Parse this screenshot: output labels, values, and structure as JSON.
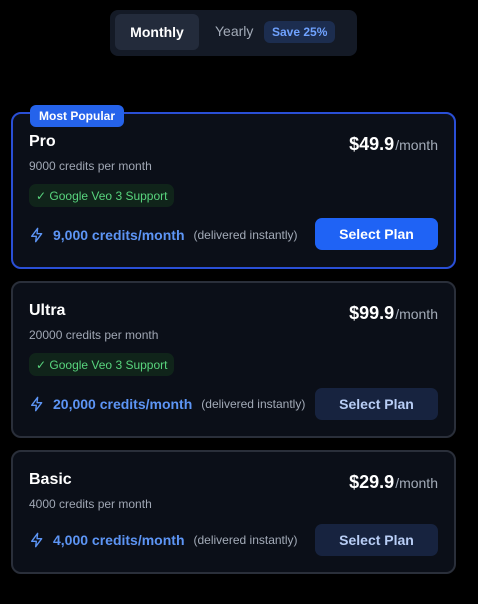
{
  "billing_toggle": {
    "monthly_label": "Monthly",
    "yearly_label": "Yearly",
    "save_badge": "Save 25%",
    "selected": "monthly"
  },
  "plans": [
    {
      "badge": "Most Popular",
      "name": "Pro",
      "subtitle": "9000 credits per month",
      "price": "$49.9",
      "period": "/month",
      "feature": "✓ Google Veo 3 Support",
      "credits": "9,000 credits/month",
      "credits_note": "(delivered instantly)",
      "button_label": "Select Plan"
    },
    {
      "name": "Ultra",
      "subtitle": "20000 credits per month",
      "price": "$99.9",
      "period": "/month",
      "feature": "✓ Google Veo 3 Support",
      "credits": "20,000 credits/month",
      "credits_note": "(delivered instantly)",
      "button_label": "Select Plan"
    },
    {
      "name": "Basic",
      "subtitle": "4000 credits per month",
      "price": "$29.9",
      "period": "/month",
      "credits": "4,000 credits/month",
      "credits_note": "(delivered instantly)",
      "button_label": "Select Plan"
    }
  ],
  "colors": {
    "accent": "#2563eb",
    "popular_border": "#2a4fd6",
    "feature_green": "#58d47d",
    "credits_blue": "#5d95f5"
  },
  "icons": {
    "credits": "lightning-bolt-icon"
  }
}
